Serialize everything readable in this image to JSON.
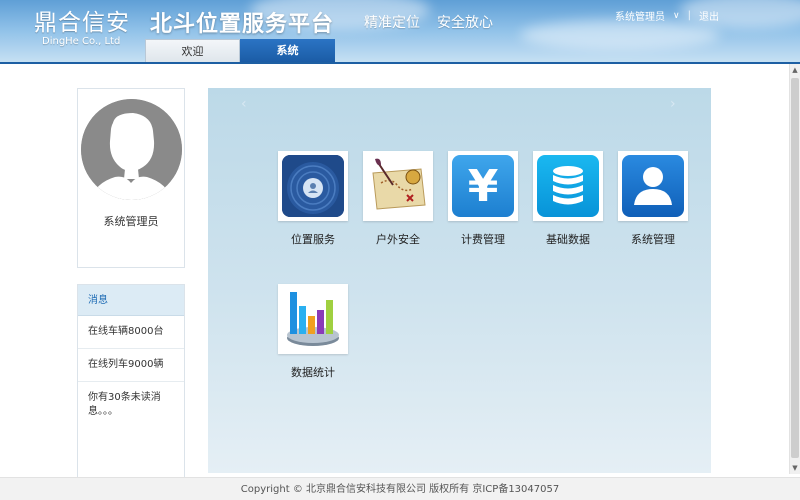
{
  "header": {
    "logo_cn": "鼎合信安",
    "logo_en": "DingHe Co., Ltd",
    "title": "北斗位置服务平台",
    "slogan1": "精准定位",
    "slogan2": "安全放心",
    "user_menu": {
      "user": "系统管理员",
      "logout": "退出"
    },
    "tabs": [
      {
        "label": "欢迎"
      },
      {
        "label": "系统",
        "active": true
      }
    ]
  },
  "profile": {
    "username": "系统管理员"
  },
  "messages": {
    "title": "消息",
    "items": [
      {
        "text": "在线车辆8000台"
      },
      {
        "text": "在线列车9000辆"
      },
      {
        "text": "你有30条未读消息。。。"
      }
    ]
  },
  "carousel": {
    "prev_icon": "‹",
    "next_icon": "›"
  },
  "apps": [
    {
      "label": "位置服务",
      "icon": "radar-icon"
    },
    {
      "label": "户外安全",
      "icon": "treasure-map-icon"
    },
    {
      "label": "计费管理",
      "icon": "yen-icon"
    },
    {
      "label": "基础数据",
      "icon": "database-icon"
    },
    {
      "label": "系统管理",
      "icon": "user-icon"
    },
    {
      "label": "数据统计",
      "icon": "bar-chart-icon"
    }
  ],
  "footer": {
    "copyright": "Copyright © 北京鼎合信安科技有限公司 版权所有 京ICP备13047057"
  },
  "colors": {
    "header_blue": "#5f9fd6",
    "tab_active": "#1b5ca6",
    "main_bg": "#cfe3ee",
    "msg_header": "#dcebf5"
  }
}
